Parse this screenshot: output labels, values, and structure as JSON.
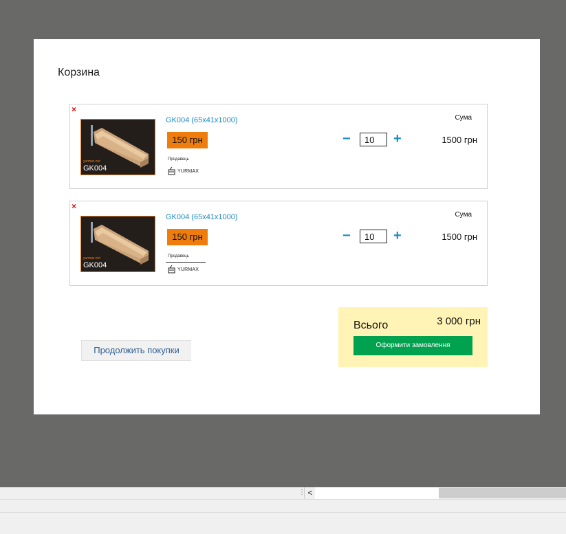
{
  "cart": {
    "title": "Корзина",
    "sum_label": "Сума",
    "seller_label": "Продавець",
    "seller_logo": "YURMAX",
    "items": [
      {
        "name": "GK004 (65x41x1000)",
        "price": "150 грн",
        "quantity": "10",
        "sum": "1500 грн",
        "thumb_code": "GK004",
        "thumb_site": "yurmax.net"
      },
      {
        "name": "GK004 (65x41x1000)",
        "price": "150 грн",
        "quantity": "10",
        "sum": "1500 грн",
        "thumb_code": "GK004",
        "thumb_site": "yurmax.net"
      }
    ],
    "minus_symbol": "−",
    "plus_symbol": "+",
    "remove_symbol": "×",
    "continue_label": "Продолжить покупки",
    "total_label": "Всього",
    "total_value": "3 000 грн",
    "checkout_label": "Оформити замовлення"
  },
  "colors": {
    "overlay": "#696968",
    "accent_blue": "#1b8bc4",
    "price_orange": "#ef7d0d",
    "checkout_green": "#00a24f",
    "total_bg": "#fff4b5",
    "remove_red": "#dd1111"
  },
  "icons": {
    "remove": "close-icon",
    "minus": "minus-icon",
    "plus": "plus-icon",
    "scroll_left": "chevron-left-icon"
  }
}
